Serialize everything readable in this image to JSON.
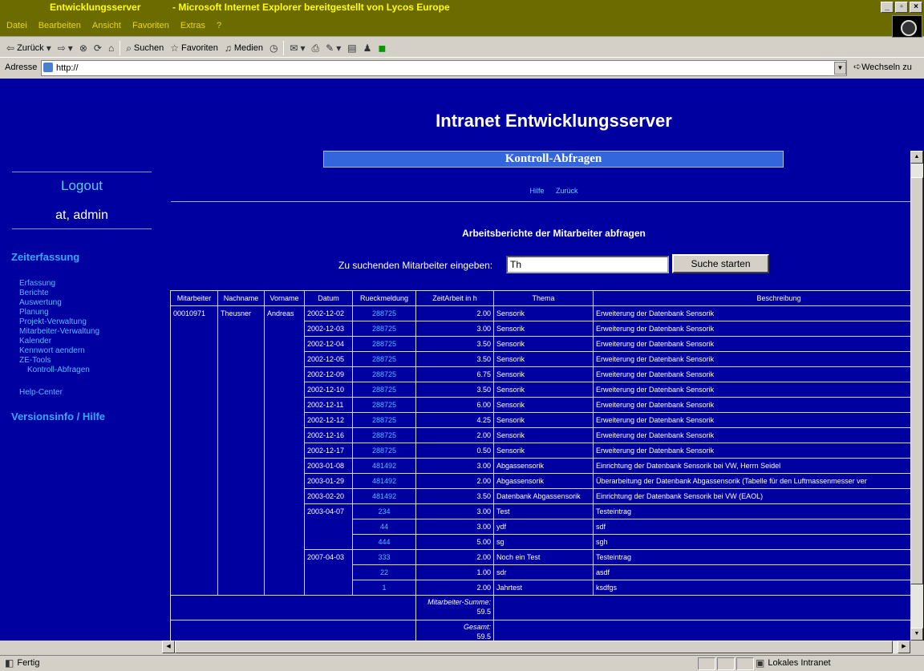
{
  "window": {
    "title_left": "Entwicklungsserver",
    "title_right": "- Microsoft Internet Explorer bereitgestellt von Lycos Europe"
  },
  "menu": [
    "Datei",
    "Bearbeiten",
    "Ansicht",
    "Favoriten",
    "Extras",
    "?"
  ],
  "toolbar": {
    "back": "Zurück",
    "search": "Suchen",
    "favorites": "Favoriten",
    "media": "Medien"
  },
  "address": {
    "label": "Adresse",
    "value": "http://",
    "go": "Wechseln zu"
  },
  "sidebar": {
    "logout": "Logout",
    "user": "at, admin",
    "section": "Zeiterfassung",
    "items": [
      {
        "label": "Erfassung"
      },
      {
        "label": "Berichte"
      },
      {
        "label": "Auswertung"
      },
      {
        "label": "Planung"
      },
      {
        "label": "Projekt-Verwaltung"
      },
      {
        "label": "Mitarbeiter-Verwaltung"
      },
      {
        "label": "Kalender"
      },
      {
        "label": "Kennwort aendern"
      },
      {
        "label": "ZE-Tools"
      },
      {
        "label": "Kontroll-Abfragen"
      }
    ],
    "help_center": "Help-Center",
    "version": "Versionsinfo / Hilfe"
  },
  "main": {
    "title": "Intranet Entwicklungsserver",
    "section_title": "Kontroll-Abfragen",
    "link_help": "Hilfe",
    "link_back": "Zurück",
    "query_title": "Arbeitsberichte der Mitarbeiter abfragen",
    "search_label": "Zu suchenden Mitarbeiter eingeben:",
    "search_value": "Th",
    "search_button": "Suche starten"
  },
  "table": {
    "headers": [
      "Mitarbeiter",
      "Nachname",
      "Vorname",
      "Datum",
      "Rueckmeldung",
      "ZeitArbeit in h",
      "Thema",
      "Beschreibung"
    ],
    "employee": {
      "id": "00010971",
      "last": "Theusner",
      "first": "Andreas"
    },
    "rows": [
      {
        "datum": "2002-12-02",
        "rm": "288725",
        "h": "2.00",
        "thema": "Sensorik",
        "besch": "Erweiterung der Datenbank Sensorik"
      },
      {
        "datum": "2002-12-03",
        "rm": "288725",
        "h": "3.00",
        "thema": "Sensorik",
        "besch": "Erweiterung der Datenbank Sensorik"
      },
      {
        "datum": "2002-12-04",
        "rm": "288725",
        "h": "3.50",
        "thema": "Sensorik",
        "besch": "Erweiterung der Datenbank Sensorik"
      },
      {
        "datum": "2002-12-05",
        "rm": "288725",
        "h": "3.50",
        "thema": "Sensorik",
        "besch": "Erweiterung der Datenbank Sensorik"
      },
      {
        "datum": "2002-12-09",
        "rm": "288725",
        "h": "6.75",
        "thema": "Sensorik",
        "besch": "Erweiterung der Datenbank Sensorik"
      },
      {
        "datum": "2002-12-10",
        "rm": "288725",
        "h": "3.50",
        "thema": "Sensorik",
        "besch": "Erweiterung der Datenbank Sensorik"
      },
      {
        "datum": "2002-12-11",
        "rm": "288725",
        "h": "6.00",
        "thema": "Sensorik",
        "besch": "Erweiterung der Datenbank Sensorik"
      },
      {
        "datum": "2002-12-12",
        "rm": "288725",
        "h": "4.25",
        "thema": "Sensorik",
        "besch": "Erweiterung der Datenbank Sensorik"
      },
      {
        "datum": "2002-12-16",
        "rm": "288725",
        "h": "2.00",
        "thema": "Sensorik",
        "besch": "Erweiterung der Datenbank Sensorik"
      },
      {
        "datum": "2002-12-17",
        "rm": "288725",
        "h": "0.50",
        "thema": "Sensorik",
        "besch": "Erweiterung der Datenbank Sensorik"
      },
      {
        "datum": "2003-01-08",
        "rm": "481492",
        "h": "3.00",
        "thema": "Abgassensorik",
        "besch": "Einrichtung der Datenbank Sensorik bei VW, Herrn Seidel"
      },
      {
        "datum": "2003-01-29",
        "rm": "481492",
        "h": "2.00",
        "thema": "Abgassensorik",
        "besch": "Überarbeitung der Datenbank Abgassensorik (Tabelle für den Luftmassenmesser ver"
      },
      {
        "datum": "2003-02-20",
        "rm": "481492",
        "h": "3.50",
        "thema": "Datenbank Abgassensorik",
        "besch": "Einrichtung der Datenbank Sensorik bei VW (EAOL)"
      },
      {
        "datum": "2003-04-07",
        "rm": "234",
        "h": "3.00",
        "thema": "Test",
        "besch": "Testeintrag"
      },
      {
        "datum": "",
        "rm": "44",
        "h": "3.00",
        "thema": "ydf",
        "besch": "sdf"
      },
      {
        "datum": "",
        "rm": "444",
        "h": "5.00",
        "thema": "sg",
        "besch": "sgh"
      },
      {
        "datum": "2007-04-03",
        "rm": "333",
        "h": "2.00",
        "thema": "Noch ein Test",
        "besch": "Testeintrag"
      },
      {
        "datum": "",
        "rm": "22",
        "h": "1.00",
        "thema": "sdr",
        "besch": "asdf"
      },
      {
        "datum": "",
        "rm": "1",
        "h": "2.00",
        "thema": "Jahrtest",
        "besch": "ksdfgs"
      }
    ],
    "sum_label": "Mitarbeiter-Summe:",
    "sum_value": "59.5",
    "total_label": "Gesamt:",
    "total_value": "59.5"
  },
  "status": {
    "left": "Fertig",
    "zone": "Lokales Intranet"
  }
}
